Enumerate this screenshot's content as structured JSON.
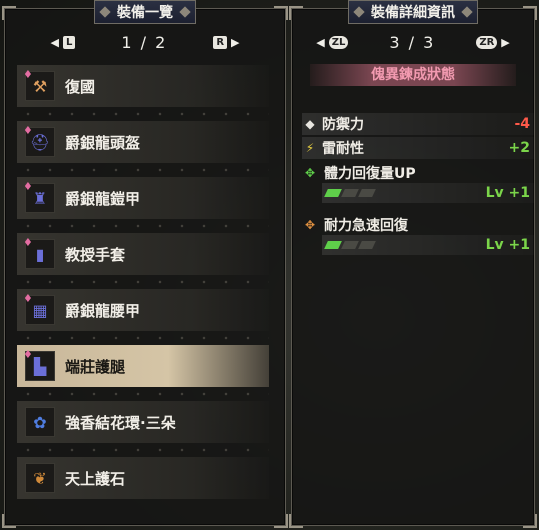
{
  "left": {
    "title": "裝備一覽",
    "prev_key": "L",
    "next_key": "R",
    "page": "1 / 2",
    "items": [
      {
        "label": "復國",
        "icon": "weapon-icon",
        "icon_glyph": "⚒",
        "icon_color": "#e0a060",
        "gem": true,
        "selected": false
      },
      {
        "label": "爵銀龍頭盔",
        "icon": "helmet-icon",
        "icon_glyph": "⛑",
        "icon_color": "#6b6fd8",
        "gem": true,
        "selected": false
      },
      {
        "label": "爵銀龍鎧甲",
        "icon": "chest-armor-icon",
        "icon_glyph": "♜",
        "icon_color": "#6b6fd8",
        "gem": true,
        "selected": false
      },
      {
        "label": "教授手套",
        "icon": "gloves-icon",
        "icon_glyph": "▮",
        "icon_color": "#6b6fd8",
        "gem": true,
        "selected": false
      },
      {
        "label": "爵銀龍腰甲",
        "icon": "waist-armor-icon",
        "icon_glyph": "▦",
        "icon_color": "#6b6fd8",
        "gem": true,
        "selected": false
      },
      {
        "label": "端莊護腿",
        "icon": "leg-armor-icon",
        "icon_glyph": "▙",
        "icon_color": "#6b6fd8",
        "gem": true,
        "selected": true
      },
      {
        "label": "強香結花環·三朵",
        "icon": "talisman-flower-icon",
        "icon_glyph": "✿",
        "icon_color": "#4f7de0",
        "gem": false,
        "selected": false
      },
      {
        "label": "天上護石",
        "icon": "charm-stone-icon",
        "icon_glyph": "❦",
        "icon_color": "#d08a3a",
        "gem": false,
        "selected": false
      }
    ]
  },
  "right": {
    "title": "裝備詳細資訊",
    "prev_key": "ZL",
    "next_key": "ZR",
    "page": "3 / 3",
    "state_title": "傀異鍊成狀態",
    "stats": [
      {
        "label": "防禦力",
        "value": "-4",
        "icon": "defense-icon",
        "icon_glyph": "◆",
        "kind": "neg"
      },
      {
        "label": "雷耐性",
        "value": "+2",
        "icon": "thunder-resist-icon",
        "icon_glyph": "⚡",
        "kind": "pos"
      }
    ],
    "skills": [
      {
        "name": "體力回復量UP",
        "level": "Lv +1",
        "icon": "recovery-up-skill-icon",
        "icon_glyph": "✥",
        "icon_color": "#5fcf4a",
        "filled": 1,
        "total": 3
      },
      {
        "name": "耐力急速回復",
        "level": "Lv +1",
        "icon": "stamina-surge-skill-icon",
        "icon_glyph": "✥",
        "icon_color": "#e09040",
        "filled": 1,
        "total": 3
      }
    ]
  }
}
